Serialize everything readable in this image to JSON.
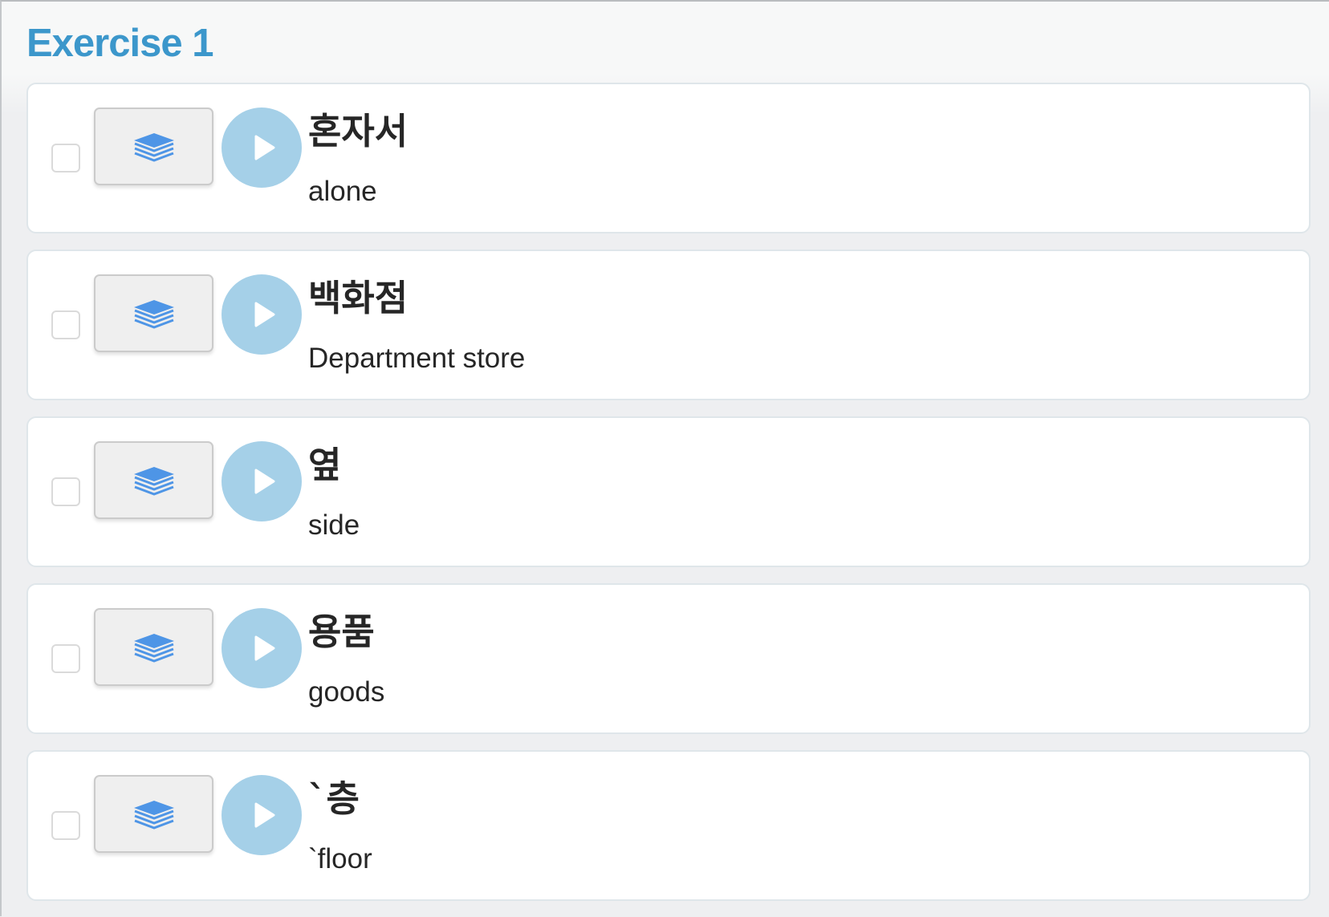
{
  "exercise": {
    "title": "Exercise 1"
  },
  "icons": {
    "flashcard": "stack-layers-icon",
    "play": "play-icon"
  },
  "colors": {
    "title": "#3c97cb",
    "play_button": "#a5d0e8",
    "layers_icon": "#4e95e6"
  },
  "items": [
    {
      "word": "혼자서",
      "meaning": "alone"
    },
    {
      "word": "백화점",
      "meaning": "Department store"
    },
    {
      "word": "옆",
      "meaning": "side"
    },
    {
      "word": "용품",
      "meaning": "goods"
    },
    {
      "word": "`층",
      "meaning": "`floor"
    }
  ]
}
